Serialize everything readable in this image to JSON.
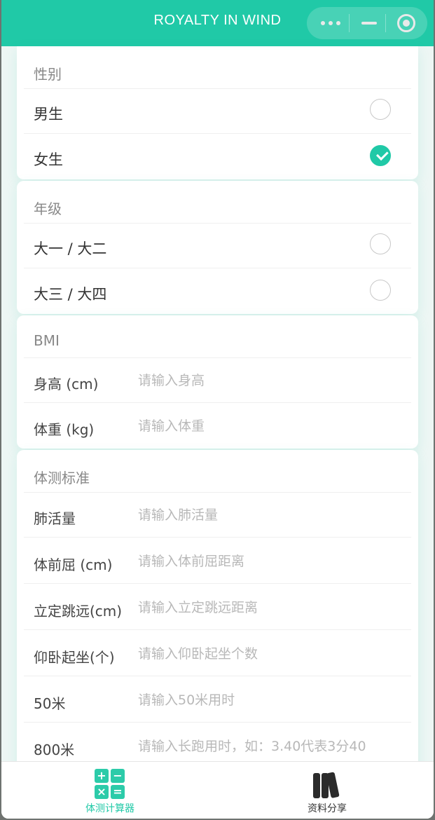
{
  "navbar": {
    "title": "ROYALTY IN WIND",
    "more_icon": "more-dots-icon",
    "minimize_icon": "minimize-icon",
    "close_icon": "target-close-icon",
    "background": "#20c9a7"
  },
  "gender": {
    "title": "性别",
    "options": [
      {
        "label": "男生",
        "checked": false
      },
      {
        "label": "女生",
        "checked": true
      }
    ]
  },
  "grade": {
    "title": "年级",
    "options": [
      {
        "label": "大一 / 大二",
        "checked": false
      },
      {
        "label": "大三 / 大四",
        "checked": false
      }
    ]
  },
  "bmi": {
    "title": "BMI",
    "fields": [
      {
        "label": "身高 (cm)",
        "placeholder": "请输入身高",
        "value": ""
      },
      {
        "label": "体重 (kg)",
        "placeholder": "请输入体重",
        "value": ""
      }
    ]
  },
  "standards": {
    "title": "体测标准",
    "fields": [
      {
        "label": "肺活量",
        "placeholder": "请输入肺活量",
        "value": ""
      },
      {
        "label": "体前屈 (cm)",
        "placeholder": "请输入体前屈距离",
        "value": ""
      },
      {
        "label": "立定跳远(cm)",
        "placeholder": "请输入立定跳远距离",
        "value": ""
      },
      {
        "label": "仰卧起坐(个)",
        "placeholder": "请输入仰卧起坐个数",
        "value": ""
      },
      {
        "label": "50米",
        "placeholder": "请输入50米用时",
        "value": ""
      },
      {
        "label": "800米",
        "placeholder": "请输入长跑用时，如：3.40代表3分40",
        "value": ""
      }
    ]
  },
  "tabbar": {
    "tabs": [
      {
        "label": "体测计算器",
        "icon": "calculator-icon",
        "active": true,
        "color": "#20c9a7"
      },
      {
        "label": "资料分享",
        "icon": "books-icon",
        "active": false,
        "color": "#333333"
      }
    ],
    "calc_symbols": [
      "+",
      "−",
      "×",
      "="
    ]
  }
}
